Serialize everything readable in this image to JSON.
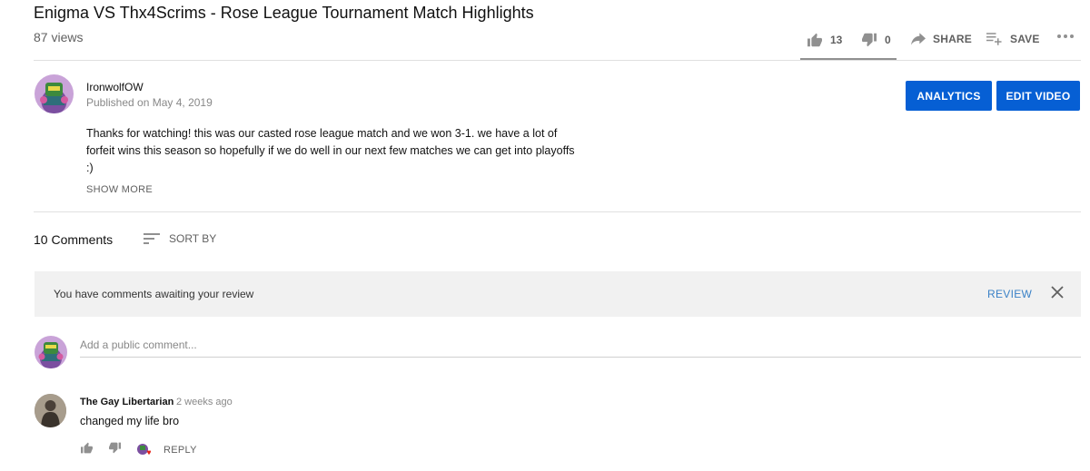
{
  "video": {
    "title": "Enigma VS Thx4Scrims - Rose League Tournament Match Highlights",
    "views": "87 views",
    "like_count": "13",
    "dislike_count": "0",
    "share_label": "SHARE",
    "save_label": "SAVE"
  },
  "channel": {
    "name": "IronwolfOW",
    "published": "Published on May 4, 2019",
    "analytics_label": "ANALYTICS",
    "edit_label": "EDIT VIDEO"
  },
  "description": {
    "line1": "Thanks for watching! this was our casted rose league match and we won 3-1. we have a lot of",
    "line2": "forfeit wins this season so hopefully if we do well in our next few matches we can get into playoffs",
    "line3": ":)",
    "show_more": "SHOW MORE"
  },
  "comments": {
    "count": "10 Comments",
    "sort_label": "SORT BY",
    "review_text": "You have comments awaiting your review",
    "review_link": "REVIEW",
    "input_placeholder": "Add a public comment...",
    "items": [
      {
        "author": "The Gay Libertarian",
        "time": "2 weeks ago",
        "text": "changed my life bro",
        "reply_label": "REPLY"
      }
    ]
  },
  "colors": {
    "accent": "#065fd4",
    "review_link": "#3b82c7",
    "heart": "#e62117"
  }
}
